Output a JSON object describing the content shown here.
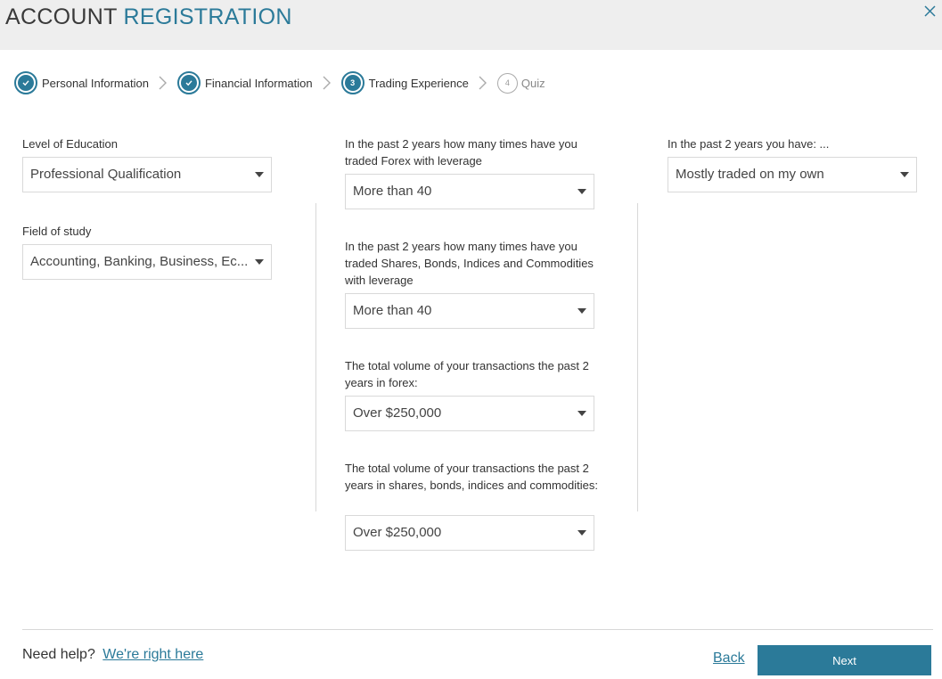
{
  "header": {
    "title_main": "ACCOUNT ",
    "title_accent": "REGISTRATION",
    "close_icon": "close-icon",
    "accent_color": "#2b7a99"
  },
  "stepper": {
    "steps": [
      {
        "label": "Personal Information",
        "state": "completed",
        "icon": "check-icon"
      },
      {
        "label": "Financial Information",
        "state": "completed",
        "icon": "check-icon"
      },
      {
        "label": "Trading Experience",
        "state": "active",
        "number": "3"
      },
      {
        "label": "Quiz",
        "state": "pending",
        "number": "4"
      }
    ]
  },
  "form": {
    "education": {
      "label": "Level of Education",
      "value": "Professional Qualification"
    },
    "field_of_study": {
      "label": "Field of study",
      "value": "Accounting, Banking, Business, Ec..."
    },
    "forex_trades": {
      "label": "In the past 2 years how many times have you traded Forex with leverage",
      "value": "More than 40"
    },
    "shares_trades": {
      "label": "In the past 2 years how many times have you traded Shares, Bonds, Indices and Commodities with leverage",
      "value": "More than 40"
    },
    "forex_volume": {
      "label": "The total volume of your transactions the past 2 years in forex:",
      "value": "Over $250,000"
    },
    "shares_volume": {
      "label": "The total volume of your transactions the past 2 years in shares, bonds, indices and commodities:",
      "value": "Over $250,000"
    },
    "past_activity": {
      "label": "In the past 2 years you have: ...",
      "value": "Mostly traded on my own"
    }
  },
  "footer": {
    "help_text": "Need help?",
    "help_link": "We're right here",
    "back_label": "Back",
    "next_label": "Next"
  }
}
